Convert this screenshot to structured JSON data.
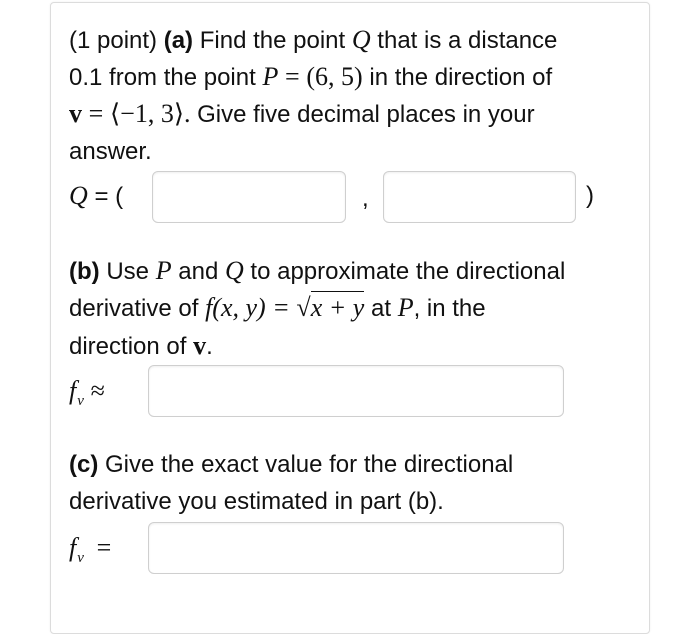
{
  "part_a": {
    "points_label": "(1 point)",
    "part_label": "(a)",
    "line1_text": "Find the point",
    "Q": "Q",
    "line1_end": "that is a distance",
    "line2_start": "0.1 from the point",
    "P": "P",
    "equals": "=",
    "P_coords": "(6, 5)",
    "line2_end": "in the direction of",
    "v": "v",
    "v_coords": "⟨−1, 3⟩.",
    "line3_end": "Give five decimal places in your",
    "line4": "answer.",
    "answer_label_Q": "Q",
    "answer_label_eq": "= (",
    "comma": ",",
    "close_paren": ")"
  },
  "part_b": {
    "part_label": "(b)",
    "line1_text": "Use",
    "P": "P",
    "and": "and",
    "Q": "Q",
    "line1_end": "to approximate the directional",
    "line2_start": "derivative of",
    "f_def": "f(x, y) =",
    "sqrt_sym": "√",
    "sqrt_arg": "x + y",
    "at": "at",
    "P2": "P",
    "line2_end": ", in the",
    "line3_start": "direction of",
    "v": "v",
    "period": ".",
    "label_f": "f",
    "label_sub": "v",
    "approx": "≈"
  },
  "part_c": {
    "part_label": "(c)",
    "line1_text": "Give the exact value for the directional",
    "line2": "derivative you estimated in part (b).",
    "label_f": "f",
    "label_sub": "v",
    "equals": "="
  },
  "inputs": {
    "q_x_value": "",
    "q_y_value": "",
    "fv_approx_value": "",
    "fv_exact_value": ""
  }
}
